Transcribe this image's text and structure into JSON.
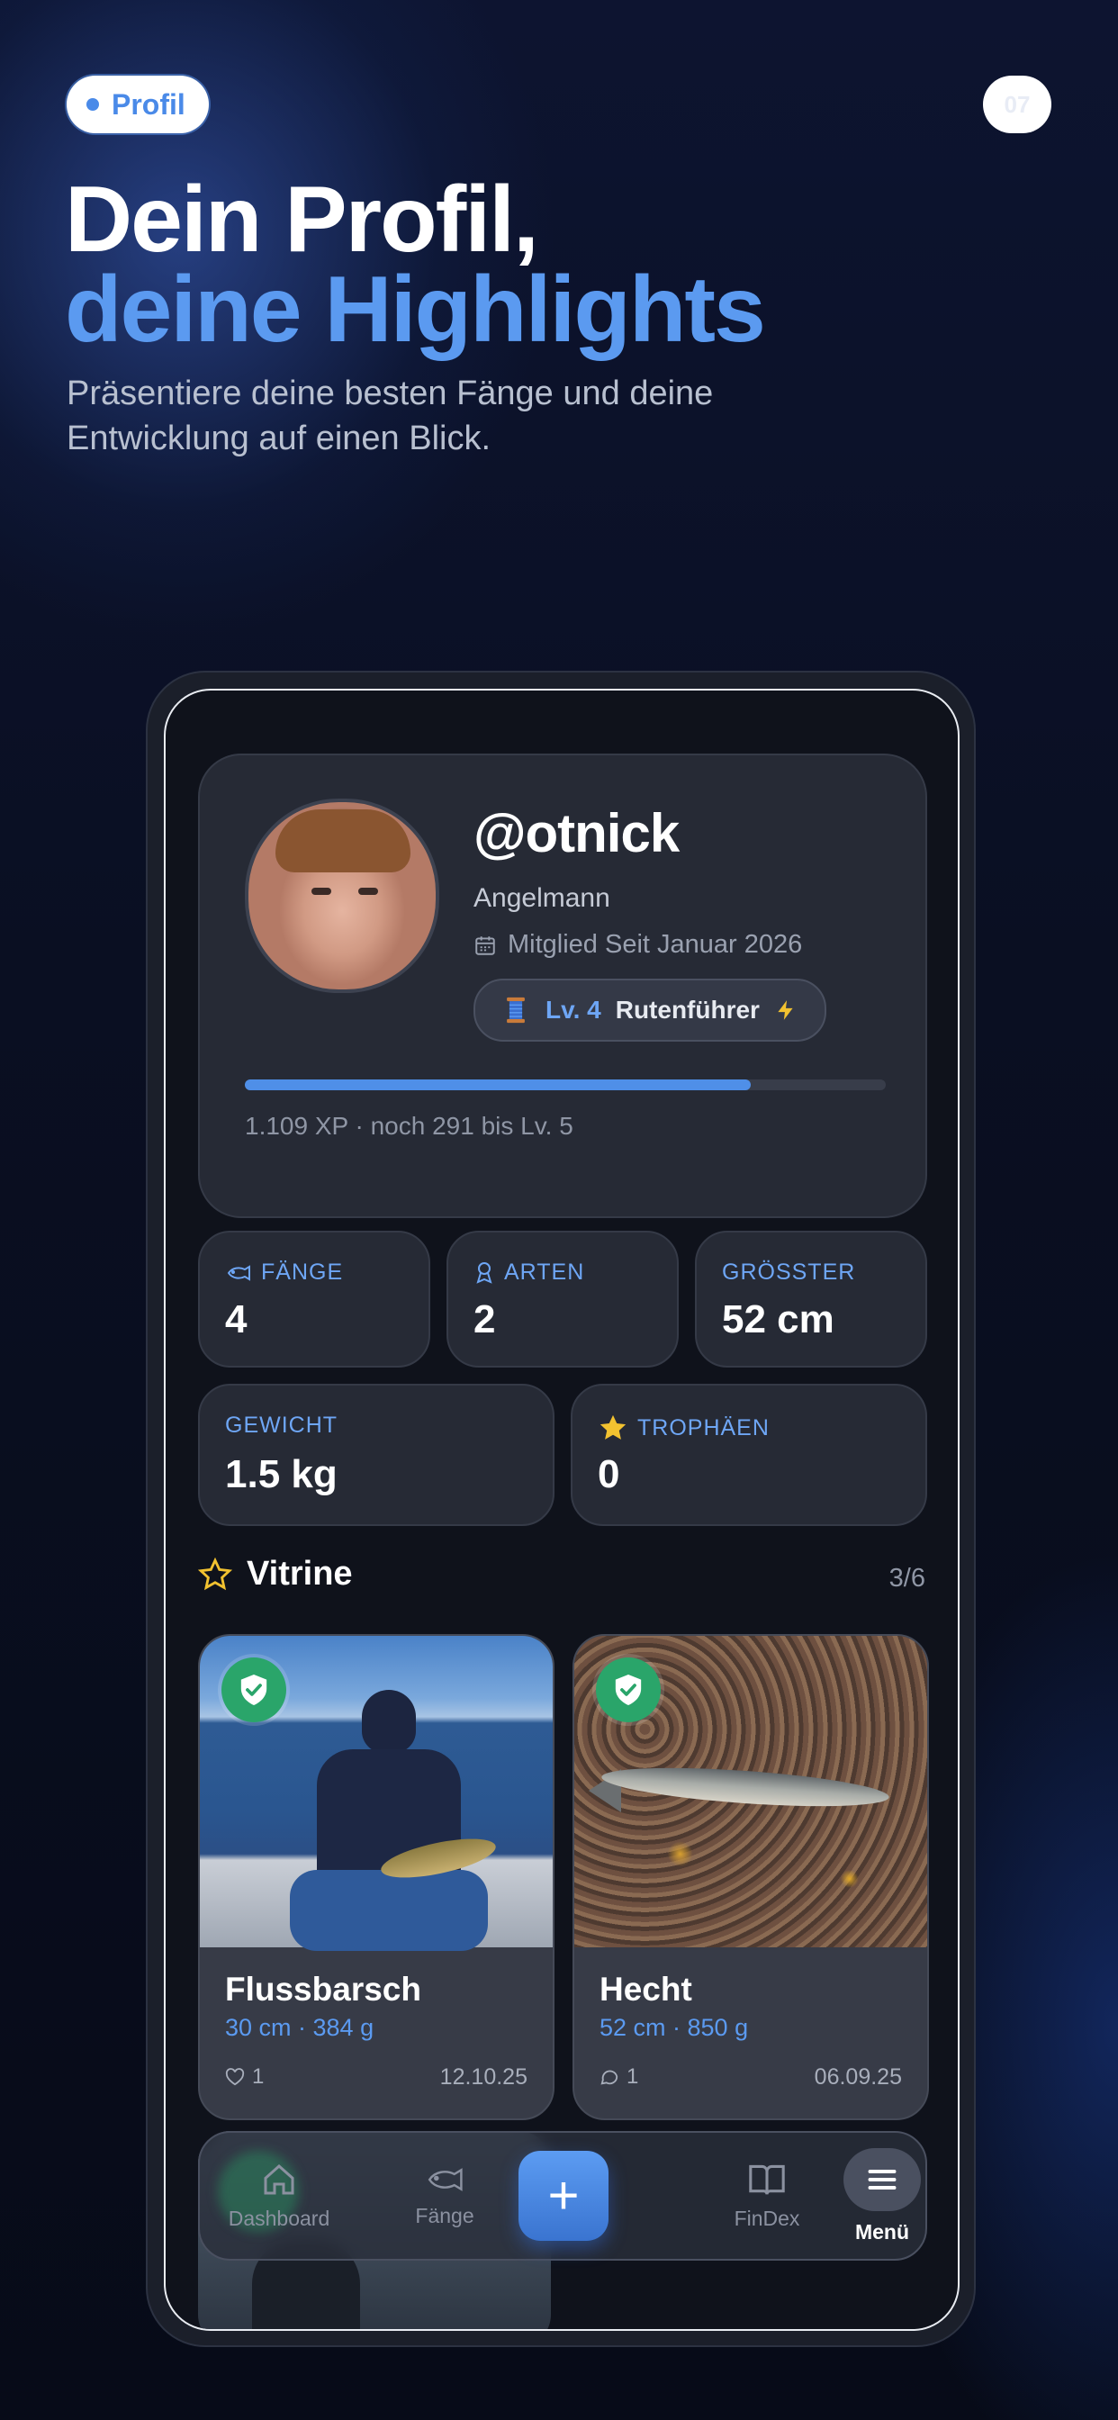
{
  "header": {
    "pill_label": "Profil",
    "page_number": "07",
    "headline_line1": "Dein Profil,",
    "headline_line2": "deine Highlights",
    "subtitle": "Präsentiere deine besten Fänge und deine Entwicklung auf einen Blick."
  },
  "profile": {
    "username": "@otnick",
    "title": "Angelmann",
    "member_since": "Mitglied Seit Januar 2026",
    "level": "Lv. 4",
    "rank": "Rutenführer",
    "xp_progress": 0.79,
    "xp_text": "1.109 XP · noch 291 bis Lv. 5"
  },
  "stats": {
    "catches_label": "FÄNGE",
    "catches_value": "4",
    "species_label": "ARTEN",
    "species_value": "2",
    "biggest_label": "GRÖSSTER",
    "biggest_value": "52 cm",
    "weight_label": "GEWICHT",
    "weight_value": "1.5 kg",
    "trophies_label": "TROPHÄEN",
    "trophies_value": "0"
  },
  "vitrine": {
    "title": "Vitrine",
    "count": "3/6",
    "items": [
      {
        "name": "Flussbarsch",
        "meta": "30 cm · 384 g",
        "reactions": "1",
        "reaction_icon": "heart-icon",
        "date": "12.10.25"
      },
      {
        "name": "Hecht",
        "meta": "52 cm · 850 g",
        "reactions": "1",
        "reaction_icon": "comment-icon",
        "date": "06.09.25"
      }
    ]
  },
  "tabbar": {
    "dashboard": "Dashboard",
    "catches": "Fänge",
    "add": "+",
    "findex": "FinDex",
    "menu": "Menü",
    "active": "menu"
  },
  "colors": {
    "accent": "#5b9af0",
    "verified": "#2aa56a",
    "card_bg": "#262a35"
  }
}
